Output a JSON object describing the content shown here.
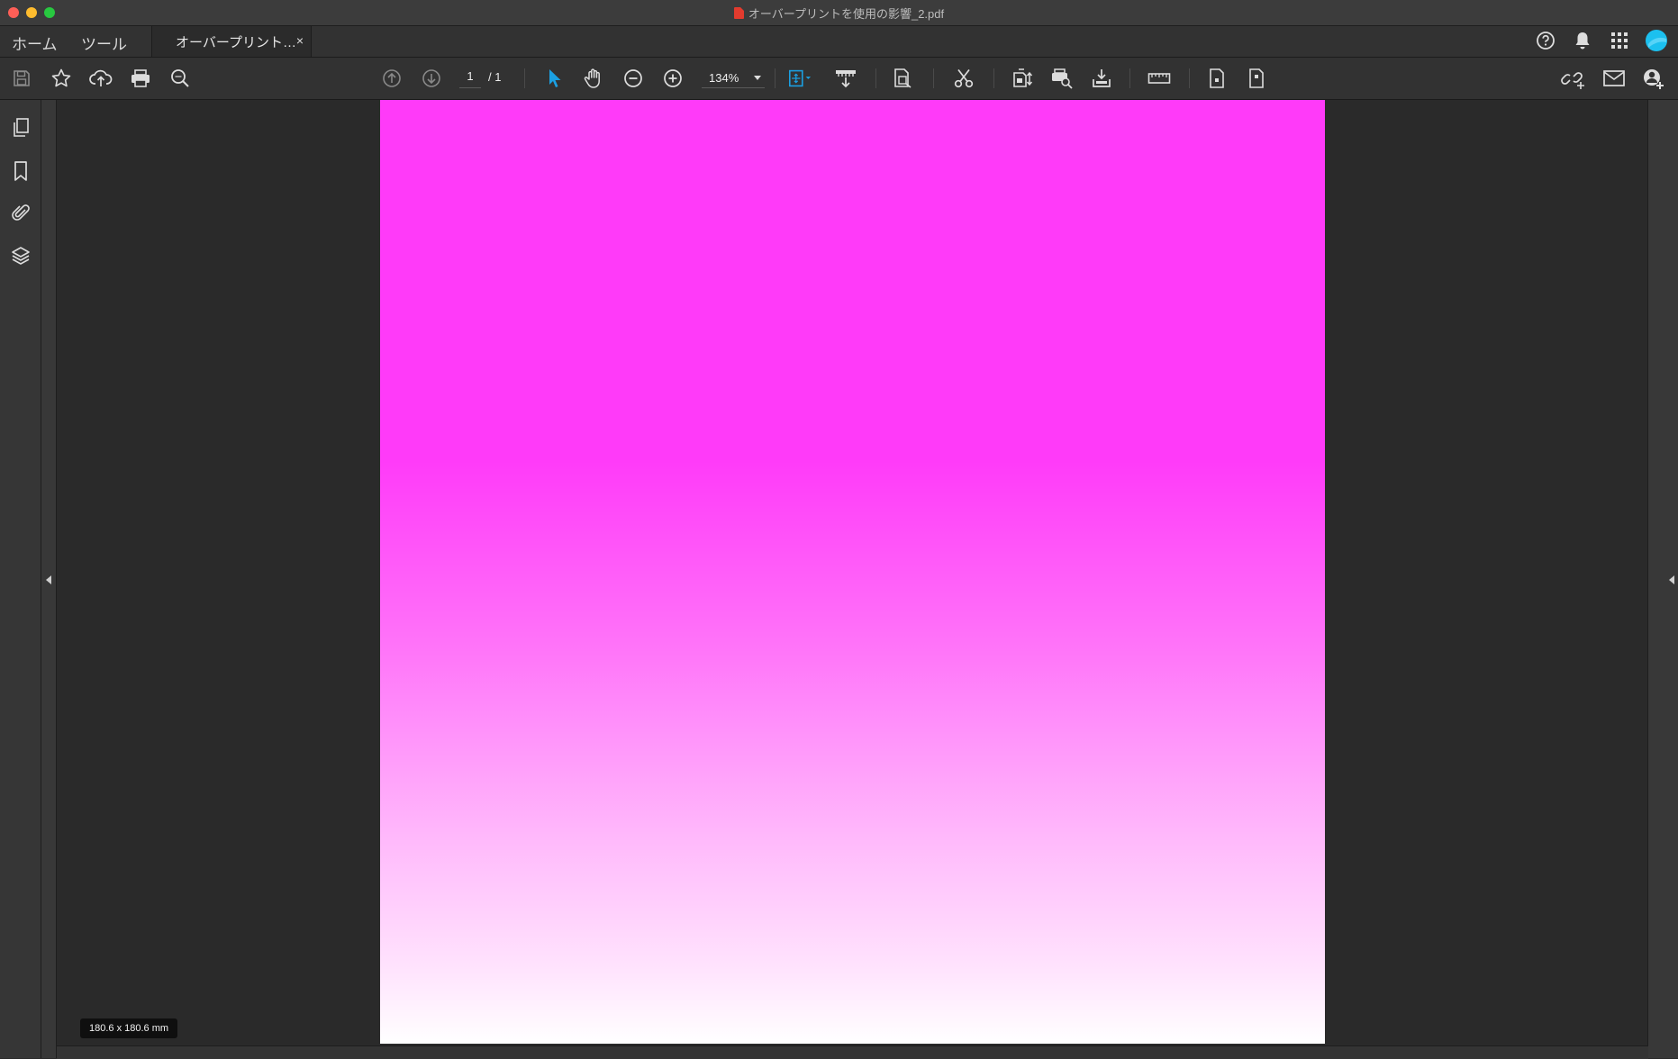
{
  "window": {
    "title": "オーバープリントを使用の影響_2.pdf"
  },
  "nav": {
    "home_label": "ホーム",
    "tools_label": "ツール"
  },
  "tab": {
    "label": "オーバープリント…",
    "close_glyph": "×"
  },
  "toolbar": {
    "page_current": "1",
    "page_total": "/ 1",
    "zoom": "134%"
  },
  "status": {
    "page_size": "180.6 x 180.6 mm"
  },
  "colors": {
    "accent": "#1ba0e2",
    "page_gradient_top": "#ff3af9",
    "page_gradient_bottom": "#ffffff",
    "avatar": "#1cc0ef"
  },
  "icons": {
    "titlebar": "pdf-file-icon",
    "top_right": [
      "help-icon",
      "bell-icon",
      "apps-grid-icon",
      "avatar-icon"
    ],
    "toolbar_left": [
      "save-icon",
      "star-icon",
      "upload-cloud-icon",
      "print-icon",
      "search-icon"
    ],
    "toolbar_center": [
      "page-up-icon",
      "page-down-icon",
      "select-arrow-icon",
      "hand-icon",
      "zoom-out-icon",
      "zoom-in-icon",
      "fit-page-icon",
      "scroll-mode-icon",
      "page-tool-icon",
      "scissors-icon",
      "replace-page-icon",
      "print-preview-icon",
      "export-icon",
      "ruler-icon",
      "page-a-icon",
      "page-b-icon"
    ],
    "toolbar_right": [
      "share-link-icon",
      "mail-icon",
      "add-user-icon"
    ],
    "left_rail": [
      "pages-icon",
      "bookmark-icon",
      "attachment-icon",
      "layers-icon"
    ]
  }
}
